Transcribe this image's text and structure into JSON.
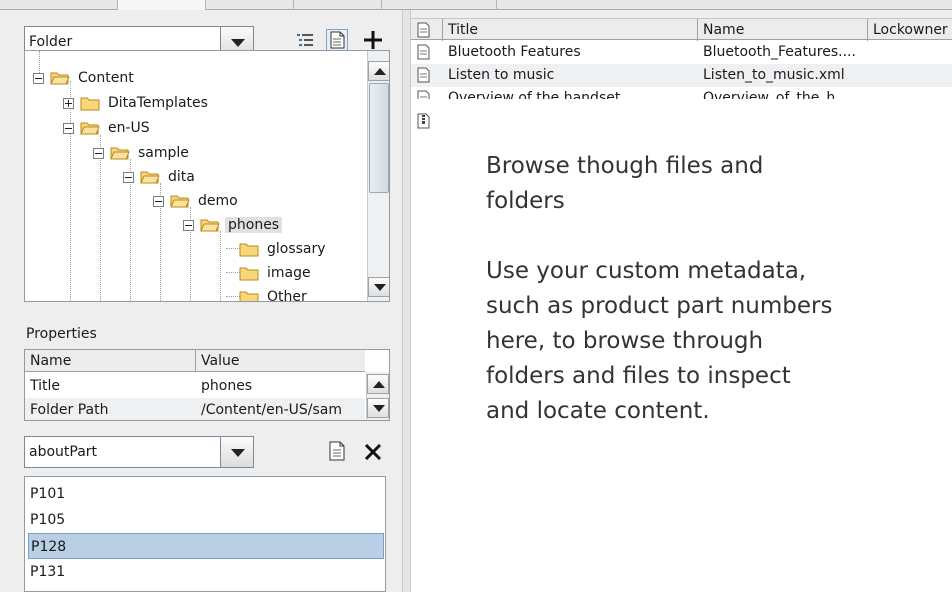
{
  "folder_panel": {
    "view_selector": {
      "value": "Folder"
    }
  },
  "folder_tree": {
    "nodes": [
      {
        "label": "Content",
        "expanded": true
      },
      {
        "label": "DitaTemplates",
        "expanded": false
      },
      {
        "label": "en-US",
        "expanded": true
      },
      {
        "label": "sample",
        "expanded": true
      },
      {
        "label": "dita",
        "expanded": true
      },
      {
        "label": "demo",
        "expanded": true
      },
      {
        "label": "phones",
        "expanded": true,
        "selected": true
      },
      {
        "label": "glossary"
      },
      {
        "label": "image"
      },
      {
        "label": "Other"
      }
    ]
  },
  "properties": {
    "title": "Properties",
    "columns": [
      "Name",
      "Value"
    ],
    "rows": [
      {
        "name": "Title",
        "value": "phones"
      },
      {
        "name": "Folder Path",
        "value": "/Content/en-US/sam"
      }
    ]
  },
  "metadata_browser": {
    "field_selector": {
      "value": "aboutPart"
    },
    "values": [
      "P101",
      "P105",
      "P128",
      "P131"
    ],
    "selected": "P128"
  },
  "file_table": {
    "columns": [
      "Title",
      "Name",
      "Lockowner"
    ],
    "rows": [
      {
        "title": "Bluetooth Features",
        "name": "Bluetooth_Features...."
      },
      {
        "title": "Listen to music",
        "name": "Listen_to_music.xml"
      },
      {
        "title": "Overview of the handset",
        "name": "Overview_of_the_h"
      }
    ]
  },
  "callout": {
    "lines_1": [
      "Browse though files and",
      "folders"
    ],
    "lines_2": [
      "Use your custom metadata,",
      "such as product part numbers",
      "here, to browse through",
      "folders and files to inspect",
      "and locate content."
    ]
  },
  "colors": {
    "selection": "#b8cfe5",
    "folder_fill": "#f9d677",
    "folder_stroke": "#b98a1c",
    "panel_bg": "#eeeeee"
  },
  "icons": {
    "tree_view": "tree-view-icon",
    "properties_page": "page-icon",
    "add": "plus-icon",
    "close": "close-icon",
    "folder": "folder-icon",
    "open_folder": "folder-open-icon",
    "document": "document-icon",
    "zip": "zip-icon"
  }
}
